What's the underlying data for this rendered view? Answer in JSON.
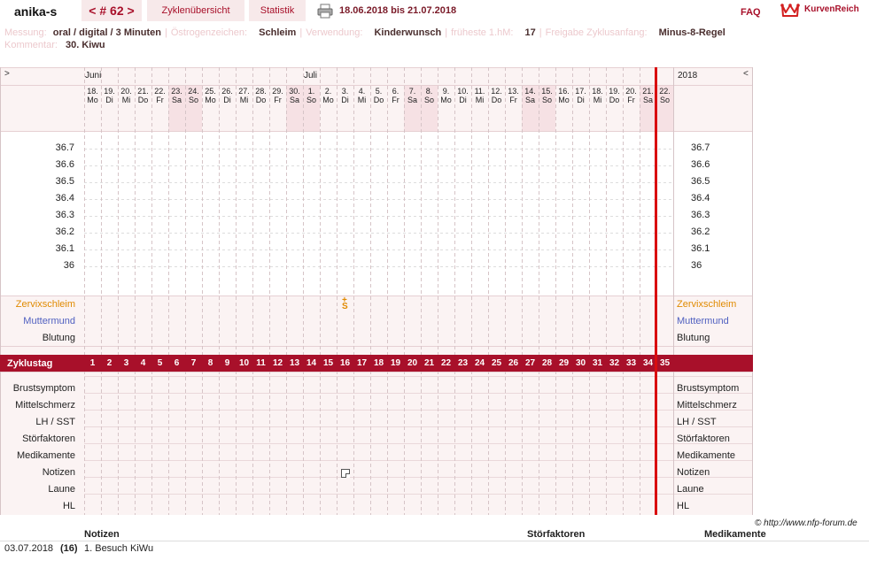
{
  "header": {
    "user": "anika-s",
    "cycle": "< # 62 >",
    "tab_overview": "Zyklenübersicht",
    "tab_stats": "Statistik",
    "date_range": "18.06.2018 bis 21.07.2018",
    "faq": "FAQ",
    "brand": "KurvenReich"
  },
  "meta": {
    "messung_label": "Messung:",
    "messung_value": "oral / digital / 3 Minuten",
    "oestrogen_label": "Östrogenzeichen:",
    "oestrogen_value": "Schleim",
    "verwendung_label": "Verwendung:",
    "verwendung_value": "Kinderwunsch",
    "fruehest_label": "früheste 1.hM:",
    "fruehest_value": "17",
    "freigabe_label": "Freigabe Zyklusanfang:",
    "freigabe_value": "Minus-8-Regel",
    "kommentar_label": "Kommentar:",
    "kommentar_value": "30. Kiwu"
  },
  "calendar": {
    "nav_left": ">",
    "nav_right": "<",
    "month_june": "Juni",
    "month_july": "Juli",
    "year": "2018",
    "days": [
      {
        "d": "18.",
        "w": "Mo",
        "we": false
      },
      {
        "d": "19.",
        "w": "Di",
        "we": false
      },
      {
        "d": "20.",
        "w": "Mi",
        "we": false
      },
      {
        "d": "21.",
        "w": "Do",
        "we": false
      },
      {
        "d": "22.",
        "w": "Fr",
        "we": false
      },
      {
        "d": "23.",
        "w": "Sa",
        "we": true
      },
      {
        "d": "24.",
        "w": "So",
        "we": true
      },
      {
        "d": "25.",
        "w": "Mo",
        "we": false
      },
      {
        "d": "26.",
        "w": "Di",
        "we": false
      },
      {
        "d": "27.",
        "w": "Mi",
        "we": false
      },
      {
        "d": "28.",
        "w": "Do",
        "we": false
      },
      {
        "d": "29.",
        "w": "Fr",
        "we": false
      },
      {
        "d": "30.",
        "w": "Sa",
        "we": true
      },
      {
        "d": "1.",
        "w": "So",
        "we": true
      },
      {
        "d": "2.",
        "w": "Mo",
        "we": false
      },
      {
        "d": "3.",
        "w": "Di",
        "we": false
      },
      {
        "d": "4.",
        "w": "Mi",
        "we": false
      },
      {
        "d": "5.",
        "w": "Do",
        "we": false
      },
      {
        "d": "6.",
        "w": "Fr",
        "we": false
      },
      {
        "d": "7.",
        "w": "Sa",
        "we": true
      },
      {
        "d": "8.",
        "w": "So",
        "we": true
      },
      {
        "d": "9.",
        "w": "Mo",
        "we": false
      },
      {
        "d": "10.",
        "w": "Di",
        "we": false
      },
      {
        "d": "11.",
        "w": "Mi",
        "we": false
      },
      {
        "d": "12.",
        "w": "Do",
        "we": false
      },
      {
        "d": "13.",
        "w": "Fr",
        "we": false
      },
      {
        "d": "14.",
        "w": "Sa",
        "we": true
      },
      {
        "d": "15.",
        "w": "So",
        "we": true
      },
      {
        "d": "16.",
        "w": "Mo",
        "we": false
      },
      {
        "d": "17.",
        "w": "Di",
        "we": false
      },
      {
        "d": "18.",
        "w": "Mi",
        "we": false
      },
      {
        "d": "19.",
        "w": "Do",
        "we": false
      },
      {
        "d": "20.",
        "w": "Fr",
        "we": false
      },
      {
        "d": "21.",
        "w": "Sa",
        "we": true
      },
      {
        "d": "22.",
        "w": "So",
        "we": true
      }
    ]
  },
  "temps": [
    "36.7",
    "36.6",
    "36.5",
    "36.4",
    "36.3",
    "36.2",
    "36.1",
    "36"
  ],
  "rows": {
    "zervix": "Zervixschleim",
    "muttermund": "Muttermund",
    "blutung": "Blutung",
    "zyklustag": "Zyklustag",
    "lower": [
      "Brustsymptom",
      "Mittelschmerz",
      "LH / SST",
      "Störfaktoren",
      "Medikamente",
      "Notizen",
      "Laune",
      "HL"
    ]
  },
  "zyklustage": [
    "1",
    "2",
    "3",
    "4",
    "5",
    "6",
    "7",
    "8",
    "9",
    "10",
    "11",
    "12",
    "13",
    "14",
    "15",
    "16",
    "17",
    "18",
    "19",
    "20",
    "21",
    "22",
    "23",
    "24",
    "25",
    "26",
    "27",
    "28",
    "29",
    "30",
    "31",
    "32",
    "33",
    "34",
    "35"
  ],
  "marks": {
    "zervix_day": 16,
    "zervix_symbol": "S",
    "notiz_day": 16
  },
  "colors": {
    "accent": "#a8102a",
    "zervix": "#e08a00",
    "muttermund": "#5060c0",
    "cycle_line": "#d90d10",
    "weekend": "#f6e1e4"
  },
  "footer": {
    "copyright": "© http://www.nfp-forum.de",
    "col_notizen": "Notizen",
    "col_stoer": "Störfaktoren",
    "col_medi": "Medikamente",
    "entries": [
      {
        "date": "03.07.2018",
        "day": "(16)",
        "note": "1. Besuch KiWu"
      }
    ]
  }
}
